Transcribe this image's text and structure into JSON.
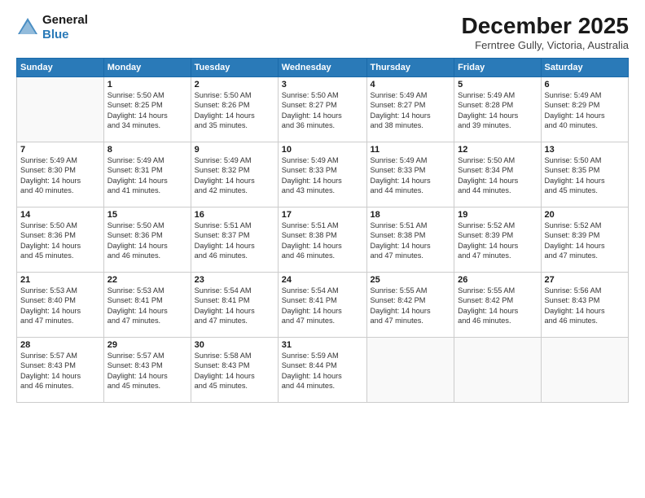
{
  "header": {
    "logo_line1": "General",
    "logo_line2": "Blue",
    "month": "December 2025",
    "location": "Ferntree Gully, Victoria, Australia"
  },
  "days_of_week": [
    "Sunday",
    "Monday",
    "Tuesday",
    "Wednesday",
    "Thursday",
    "Friday",
    "Saturday"
  ],
  "weeks": [
    [
      {
        "num": "",
        "info": ""
      },
      {
        "num": "1",
        "info": "Sunrise: 5:50 AM\nSunset: 8:25 PM\nDaylight: 14 hours\nand 34 minutes."
      },
      {
        "num": "2",
        "info": "Sunrise: 5:50 AM\nSunset: 8:26 PM\nDaylight: 14 hours\nand 35 minutes."
      },
      {
        "num": "3",
        "info": "Sunrise: 5:50 AM\nSunset: 8:27 PM\nDaylight: 14 hours\nand 36 minutes."
      },
      {
        "num": "4",
        "info": "Sunrise: 5:49 AM\nSunset: 8:27 PM\nDaylight: 14 hours\nand 38 minutes."
      },
      {
        "num": "5",
        "info": "Sunrise: 5:49 AM\nSunset: 8:28 PM\nDaylight: 14 hours\nand 39 minutes."
      },
      {
        "num": "6",
        "info": "Sunrise: 5:49 AM\nSunset: 8:29 PM\nDaylight: 14 hours\nand 40 minutes."
      }
    ],
    [
      {
        "num": "7",
        "info": "Sunrise: 5:49 AM\nSunset: 8:30 PM\nDaylight: 14 hours\nand 40 minutes."
      },
      {
        "num": "8",
        "info": "Sunrise: 5:49 AM\nSunset: 8:31 PM\nDaylight: 14 hours\nand 41 minutes."
      },
      {
        "num": "9",
        "info": "Sunrise: 5:49 AM\nSunset: 8:32 PM\nDaylight: 14 hours\nand 42 minutes."
      },
      {
        "num": "10",
        "info": "Sunrise: 5:49 AM\nSunset: 8:33 PM\nDaylight: 14 hours\nand 43 minutes."
      },
      {
        "num": "11",
        "info": "Sunrise: 5:49 AM\nSunset: 8:33 PM\nDaylight: 14 hours\nand 44 minutes."
      },
      {
        "num": "12",
        "info": "Sunrise: 5:50 AM\nSunset: 8:34 PM\nDaylight: 14 hours\nand 44 minutes."
      },
      {
        "num": "13",
        "info": "Sunrise: 5:50 AM\nSunset: 8:35 PM\nDaylight: 14 hours\nand 45 minutes."
      }
    ],
    [
      {
        "num": "14",
        "info": "Sunrise: 5:50 AM\nSunset: 8:36 PM\nDaylight: 14 hours\nand 45 minutes."
      },
      {
        "num": "15",
        "info": "Sunrise: 5:50 AM\nSunset: 8:36 PM\nDaylight: 14 hours\nand 46 minutes."
      },
      {
        "num": "16",
        "info": "Sunrise: 5:51 AM\nSunset: 8:37 PM\nDaylight: 14 hours\nand 46 minutes."
      },
      {
        "num": "17",
        "info": "Sunrise: 5:51 AM\nSunset: 8:38 PM\nDaylight: 14 hours\nand 46 minutes."
      },
      {
        "num": "18",
        "info": "Sunrise: 5:51 AM\nSunset: 8:38 PM\nDaylight: 14 hours\nand 47 minutes."
      },
      {
        "num": "19",
        "info": "Sunrise: 5:52 AM\nSunset: 8:39 PM\nDaylight: 14 hours\nand 47 minutes."
      },
      {
        "num": "20",
        "info": "Sunrise: 5:52 AM\nSunset: 8:39 PM\nDaylight: 14 hours\nand 47 minutes."
      }
    ],
    [
      {
        "num": "21",
        "info": "Sunrise: 5:53 AM\nSunset: 8:40 PM\nDaylight: 14 hours\nand 47 minutes."
      },
      {
        "num": "22",
        "info": "Sunrise: 5:53 AM\nSunset: 8:41 PM\nDaylight: 14 hours\nand 47 minutes."
      },
      {
        "num": "23",
        "info": "Sunrise: 5:54 AM\nSunset: 8:41 PM\nDaylight: 14 hours\nand 47 minutes."
      },
      {
        "num": "24",
        "info": "Sunrise: 5:54 AM\nSunset: 8:41 PM\nDaylight: 14 hours\nand 47 minutes."
      },
      {
        "num": "25",
        "info": "Sunrise: 5:55 AM\nSunset: 8:42 PM\nDaylight: 14 hours\nand 47 minutes."
      },
      {
        "num": "26",
        "info": "Sunrise: 5:55 AM\nSunset: 8:42 PM\nDaylight: 14 hours\nand 46 minutes."
      },
      {
        "num": "27",
        "info": "Sunrise: 5:56 AM\nSunset: 8:43 PM\nDaylight: 14 hours\nand 46 minutes."
      }
    ],
    [
      {
        "num": "28",
        "info": "Sunrise: 5:57 AM\nSunset: 8:43 PM\nDaylight: 14 hours\nand 46 minutes."
      },
      {
        "num": "29",
        "info": "Sunrise: 5:57 AM\nSunset: 8:43 PM\nDaylight: 14 hours\nand 45 minutes."
      },
      {
        "num": "30",
        "info": "Sunrise: 5:58 AM\nSunset: 8:43 PM\nDaylight: 14 hours\nand 45 minutes."
      },
      {
        "num": "31",
        "info": "Sunrise: 5:59 AM\nSunset: 8:44 PM\nDaylight: 14 hours\nand 44 minutes."
      },
      {
        "num": "",
        "info": ""
      },
      {
        "num": "",
        "info": ""
      },
      {
        "num": "",
        "info": ""
      }
    ]
  ]
}
